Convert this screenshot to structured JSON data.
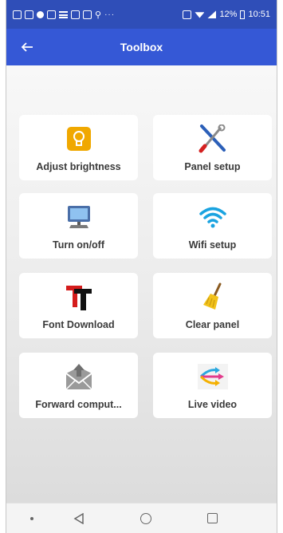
{
  "status_bar": {
    "battery": "12%",
    "time": "10:51"
  },
  "app_bar": {
    "title": "Toolbox",
    "back_icon": "arrow-left-icon"
  },
  "tools": [
    {
      "label": "Adjust brightness",
      "icon": "lightbulb-icon"
    },
    {
      "label": "Panel setup",
      "icon": "wrench-screwdriver-icon"
    },
    {
      "label": "Turn on/off",
      "icon": "monitor-icon"
    },
    {
      "label": "Wifi setup",
      "icon": "wifi-icon"
    },
    {
      "label": "Font Download",
      "icon": "font-icon"
    },
    {
      "label": "Clear panel",
      "icon": "broom-icon"
    },
    {
      "label": "Forward comput...",
      "icon": "envelope-upload-icon"
    },
    {
      "label": "Live video",
      "icon": "video-arrows-icon"
    }
  ],
  "colors": {
    "status_bar": "#2f4eb8",
    "app_bar": "#3558d6",
    "card_bg": "#ffffff",
    "wifi": "#1aa3e0",
    "bulb": "#f0a800"
  }
}
